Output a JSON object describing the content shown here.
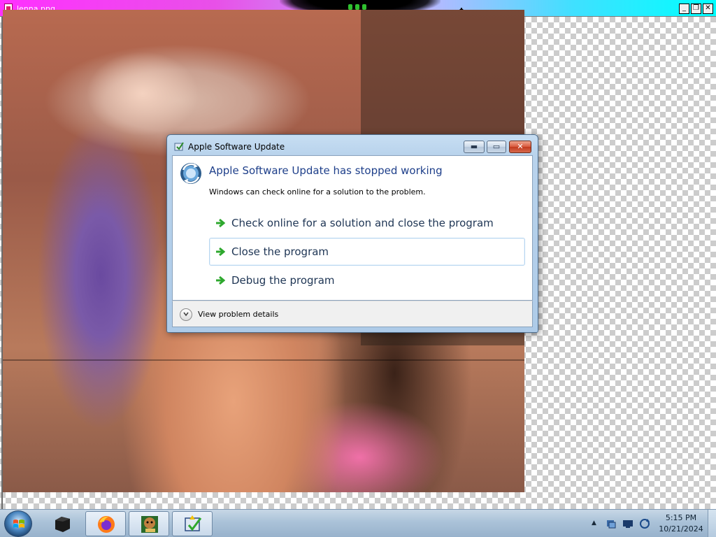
{
  "viewer": {
    "title": "lenna.png",
    "icons": {
      "file": "image-file-icon",
      "move": "move-cursor-icon",
      "minimize": "minimize-icon",
      "restore": "restore-icon",
      "close": "close-icon"
    }
  },
  "dialog": {
    "title": "Apple Software Update",
    "heading": "Apple Software Update has stopped working",
    "subheading": "Windows can check online for a solution to the problem.",
    "options": [
      {
        "label": "Check online for a solution and close the program"
      },
      {
        "label": "Close the program"
      },
      {
        "label": "Debug the program"
      }
    ],
    "details_label": "View problem details",
    "colors": {
      "heading": "#1e3f8a",
      "option_text": "#1e3554",
      "arrow": "#2ea82e",
      "close_button": "#c23a1e"
    }
  },
  "taskbar": {
    "pinned": [
      {
        "name": "black-cube-app-icon"
      },
      {
        "name": "firefox-icon"
      },
      {
        "name": "box-app-icon"
      },
      {
        "name": "software-update-icon"
      }
    ],
    "tray": [
      "tray-chevron-up-icon",
      "network-icon",
      "monitor-icon",
      "sync-icon"
    ],
    "clock": {
      "time": "5:15 PM",
      "date": "10/21/2024"
    }
  }
}
